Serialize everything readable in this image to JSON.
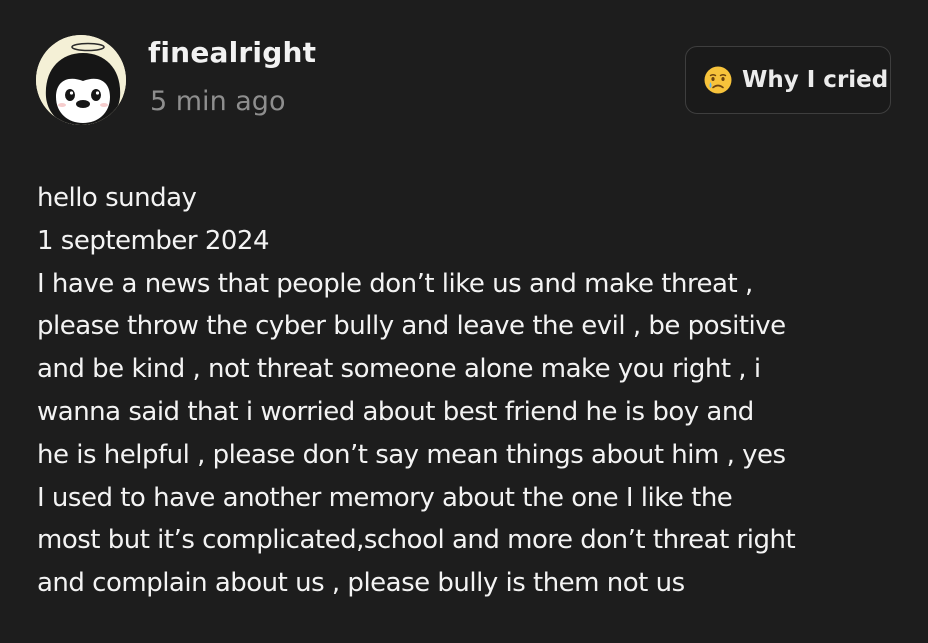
{
  "post": {
    "author": "finealright",
    "time_ago": "5 min ago",
    "mood": {
      "emoji": "crying-face-icon",
      "label": "Why I cried"
    },
    "lines": [
      "hello sunday",
      "1 september 2024",
      "I have a news that people don’t like us and make threat ,",
      "please throw the cyber bully and leave the evil , be positive",
      "and be kind , not threat someone alone make you right , i",
      "wanna said that i worried about best friend he is boy and",
      "he is helpful , please don’t say mean things about him , yes",
      "I used to have another memory about the one I like the",
      "most but it’s complicated,school and more don’t threat right",
      "and complain about us , please bully is them not us"
    ]
  },
  "colors": {
    "background": "#1d1d1d",
    "text": "#f3f3f3",
    "muted": "#8e8e8e",
    "pill_border": "#3e3e3e",
    "avatar_bg": "#f4f0d6"
  }
}
